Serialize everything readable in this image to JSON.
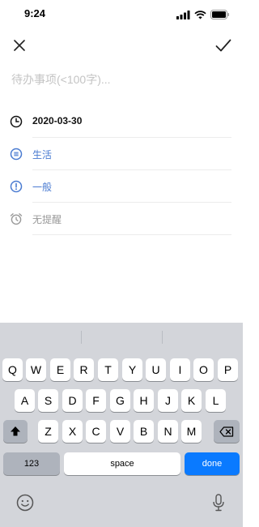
{
  "status_bar": {
    "time": "9:24"
  },
  "form": {
    "placeholder": "待办事项(<100字)...",
    "date": "2020-03-30",
    "category": "生活",
    "priority": "一般",
    "reminder": "无提醒"
  },
  "colors": {
    "accent": "#4a7bd1",
    "muted": "#999999",
    "text": "#111111",
    "keyboard_bg": "#d3d5da",
    "done_blue": "#0a7aff"
  },
  "icons": [
    "close-icon",
    "checkmark-icon",
    "clock-icon",
    "category-icon",
    "priority-icon",
    "alarm-icon",
    "shift-icon",
    "backspace-icon",
    "emoji-icon",
    "mic-icon"
  ],
  "keyboard": {
    "row1": [
      "Q",
      "W",
      "E",
      "R",
      "T",
      "Y",
      "U",
      "I",
      "O",
      "P"
    ],
    "row2": [
      "A",
      "S",
      "D",
      "F",
      "G",
      "H",
      "J",
      "K",
      "L"
    ],
    "row3": [
      "Z",
      "X",
      "C",
      "V",
      "B",
      "N",
      "M"
    ],
    "numbers_label": "123",
    "space_label": "space",
    "done_label": "done"
  }
}
